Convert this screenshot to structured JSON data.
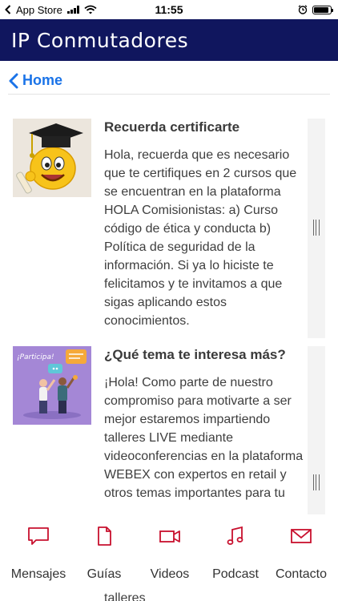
{
  "status_bar": {
    "carrier": "App Store",
    "time": "11:55",
    "battery_level": 0.9
  },
  "header": {
    "title": "IP Conmutadores"
  },
  "nav": {
    "back_label": "Home",
    "back_icon": "chevron-left-icon"
  },
  "cards": [
    {
      "title": "Recuerda certificarte",
      "text": "Hola, recuerda que es necesario que te certifiques en 2 cursos que se encuentran en la plataforma HOLA Comisionistas: a) Curso código de ética y conducta b) Política de seguridad de la información. Si ya lo hiciste te felicitamos y te invitamos a que sigas aplicando estos conocimientos.",
      "image": "graduation-emoji"
    },
    {
      "title": "¿Qué tema te interesa más?",
      "text": "¡Hola! Como parte de nuestro compromiso para motivarte a ser mejor estaremos impartiendo talleres LIVE mediante videoconferencias en la plataforma WEBEX con expertos en retail y otros temas importantes para tu",
      "image_caption": "¡Participa!"
    }
  ],
  "peek_text": "talleres",
  "tabs": [
    {
      "label": "Mensajes",
      "icon": "chat-bubble-icon"
    },
    {
      "label": "Guías",
      "icon": "document-icon"
    },
    {
      "label": "Videos",
      "icon": "video-camera-icon"
    },
    {
      "label": "Podcast",
      "icon": "music-note-icon"
    },
    {
      "label": "Contacto",
      "icon": "mail-icon"
    }
  ],
  "colors": {
    "header_bg": "#10165e",
    "link": "#1a73e8",
    "tab_icon": "#c8102e"
  }
}
